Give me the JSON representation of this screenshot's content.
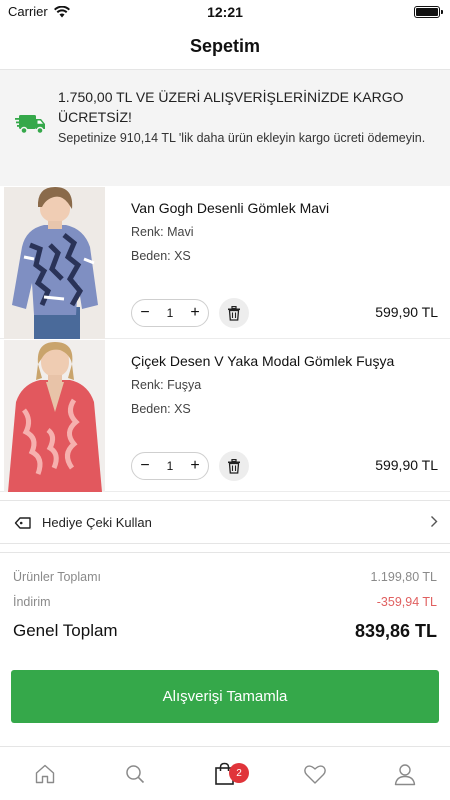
{
  "status_bar": {
    "carrier": "Carrier",
    "time": "12:21"
  },
  "header": {
    "title": "Sepetim"
  },
  "shipping_banner": {
    "title": "1.750,00 TL VE ÜZERİ ALIŞVERİŞLERİNİZDE KARGO ÜCRETSİZ!",
    "subtitle": "Sepetinize 910,14 TL 'lik daha ürün ekleyin kargo ücreti ödemeyin.",
    "icon": "truck-icon",
    "icon_color": "#35a84a"
  },
  "cart": {
    "items": [
      {
        "name": "Van Gogh Desenli Gömlek Mavi",
        "color": "Renk: Mavi",
        "size": "Beden: XS",
        "quantity": "1",
        "price": "599,90 TL"
      },
      {
        "name": "Çiçek Desen V Yaka Modal Gömlek Fuşya",
        "color": "Renk: Fuşya",
        "size": "Beden: XS",
        "quantity": "1",
        "price": "599,90 TL"
      }
    ],
    "minus_symbol": "−",
    "plus_symbol": "+"
  },
  "gift_card": {
    "label": "Hediye Çeki Kullan",
    "icon": "tag-icon"
  },
  "summary": {
    "subtotal_label": "Ürünler Toplamı",
    "subtotal_value": "1.199,80 TL",
    "discount_label": "İndirim",
    "discount_value": "-359,94 TL",
    "total_label": "Genel Toplam",
    "total_value": "839,86 TL",
    "discount_color": "#e06060"
  },
  "checkout": {
    "label": "Alışverişi Tamamla",
    "color": "#35a84a"
  },
  "tab_bar": {
    "tabs": [
      {
        "icon": "home-icon"
      },
      {
        "icon": "search-icon"
      },
      {
        "icon": "cart-icon",
        "badge": "2"
      },
      {
        "icon": "heart-icon"
      },
      {
        "icon": "profile-icon"
      }
    ],
    "badge_color": "#e0343a"
  }
}
